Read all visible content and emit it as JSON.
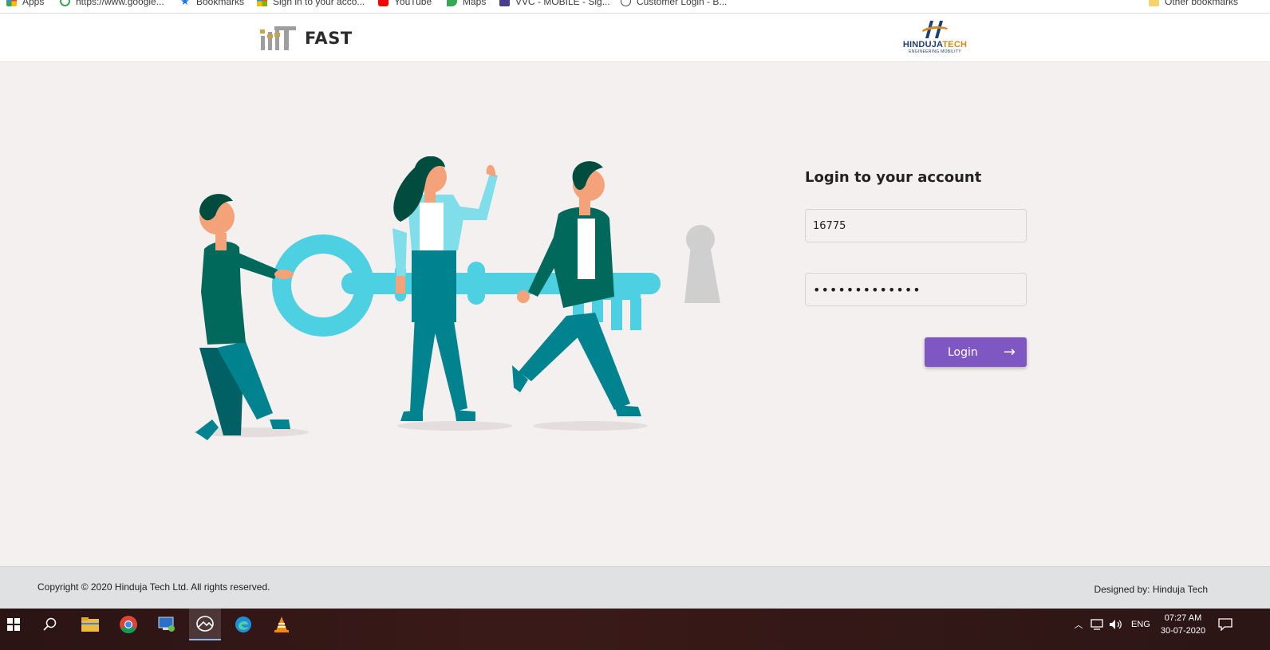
{
  "browser": {
    "bookmarks": [
      {
        "label": "Apps",
        "icon": "apps-grid-icon"
      },
      {
        "label": "https://www.google...",
        "icon": "google-icon"
      },
      {
        "label": "Bookmarks",
        "icon": "star-icon"
      },
      {
        "label": "Sign in to your acco...",
        "icon": "microsoft-icon"
      },
      {
        "label": "YouTube",
        "icon": "youtube-icon"
      },
      {
        "label": "Maps",
        "icon": "maps-pin-icon"
      },
      {
        "label": "VVC - MOBILE - Sig...",
        "icon": "site-icon"
      },
      {
        "label": "Customer Login - B...",
        "icon": "globe-icon"
      }
    ],
    "other_bookmarks": "Other bookmarks"
  },
  "header": {
    "app_name": "FAST",
    "partner_name_main": "HINDUJA",
    "partner_name_accent": "TECH",
    "partner_tagline": "ENGINEERING MOBILITY"
  },
  "login": {
    "title": "Login to your account",
    "username_value": "16775",
    "password_value": "•••••••••••••",
    "button_label": "Login",
    "button_arrow": "→"
  },
  "footer": {
    "copyright": "Copyright © 2020 Hinduja Tech Ltd. All rights reserved.",
    "designed_by": "Designed by: Hinduja Tech"
  },
  "taskbar": {
    "language": "ENG",
    "time": "07:27 AM",
    "date": "30-07-2020"
  },
  "colors": {
    "accent": "#7e57c2",
    "background": "#f4f0ef",
    "teal": "#00838f",
    "key": "#4dd0e1"
  }
}
